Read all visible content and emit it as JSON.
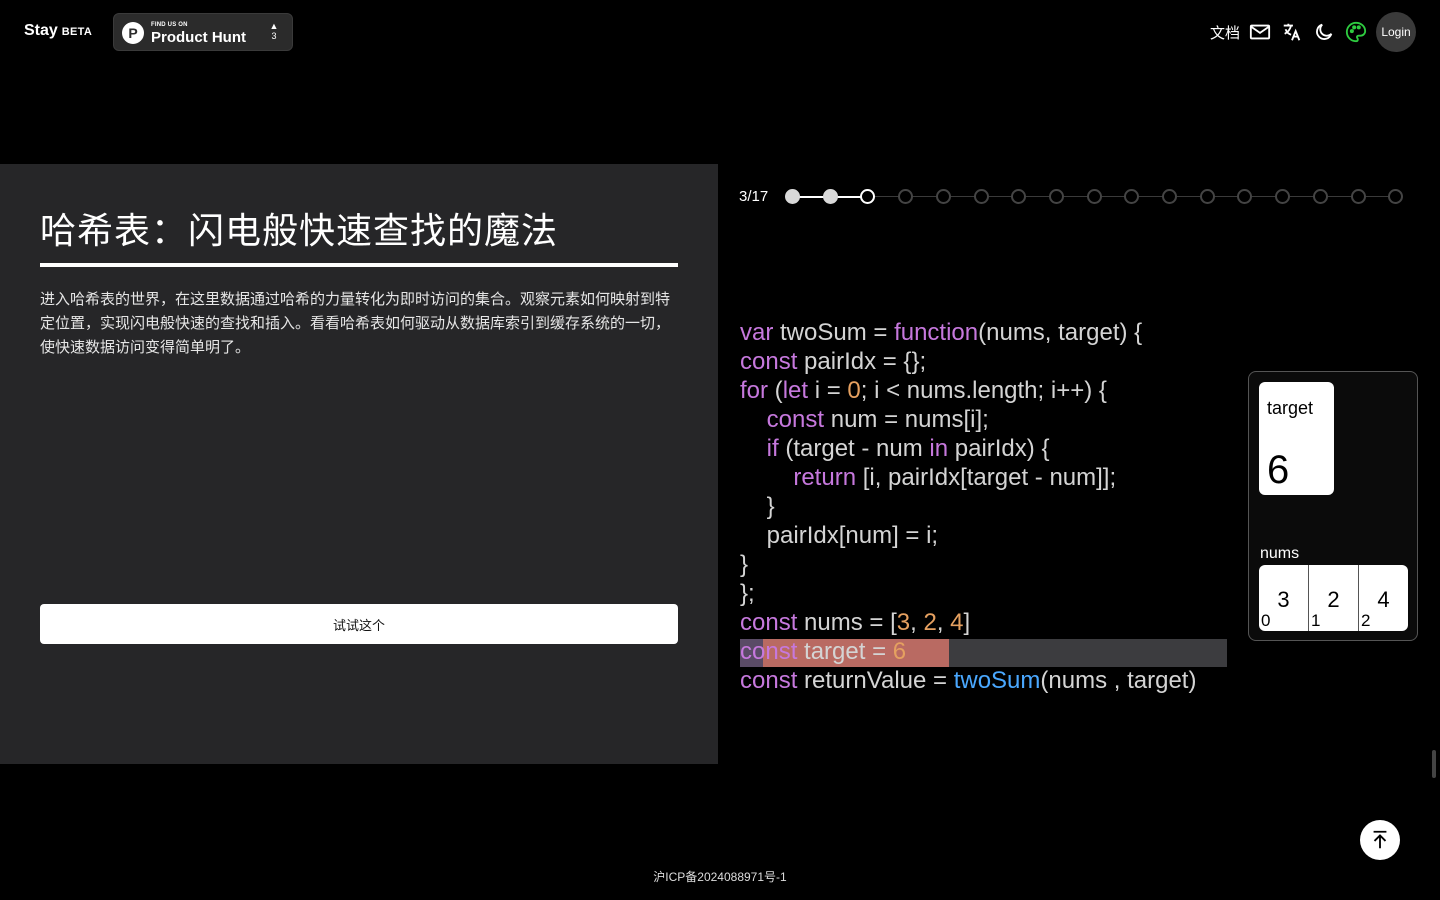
{
  "header": {
    "brand": "Stay",
    "brand_tag": "BETA",
    "product_hunt": {
      "small": "FIND US ON",
      "name": "Product Hunt",
      "logo": "P",
      "arrow": "▲",
      "votes": "3"
    },
    "docs": "文档",
    "login": "Login",
    "icons": [
      "mail-icon",
      "translate-icon",
      "moon-icon",
      "palette-icon"
    ]
  },
  "lesson": {
    "title": "哈希表：闪电般快速查找的魔法",
    "description": "进入哈希表的世界，在这里数据通过哈希的力量转化为即时访问的集合。观察元素如何映射到特定位置，实现闪电般快速的查找和插入。看看哈希表如何驱动从数据库索引到缓存系统的一切，使快速数据访问变得简单明了。",
    "try_button": "试试这个"
  },
  "progress": {
    "label": "3/17",
    "current": 3,
    "total": 17
  },
  "code_lines": [
    [
      {
        "t": "var",
        "c": "kw"
      },
      {
        "t": " twoSum = "
      },
      {
        "t": "function",
        "c": "kw"
      },
      {
        "t": "(nums, target) {"
      }
    ],
    [
      {
        "t": "const",
        "c": "kw"
      },
      {
        "t": " pairIdx = {};"
      }
    ],
    [
      {
        "t": "for",
        "c": "kw"
      },
      {
        "t": " ("
      },
      {
        "t": "let",
        "c": "kw"
      },
      {
        "t": " i = "
      },
      {
        "t": "0",
        "c": "num"
      },
      {
        "t": "; i < nums.length; i++) {"
      }
    ],
    [
      {
        "t": "    "
      },
      {
        "t": "const",
        "c": "kw"
      },
      {
        "t": " num = nums[i];"
      }
    ],
    [
      {
        "t": "    "
      },
      {
        "t": "if",
        "c": "kw"
      },
      {
        "t": " (target - num "
      },
      {
        "t": "in",
        "c": "kw"
      },
      {
        "t": " pairIdx) {"
      }
    ],
    [
      {
        "t": "        "
      },
      {
        "t": "return",
        "c": "kw"
      },
      {
        "t": " [i, pairIdx[target - num]];"
      }
    ],
    [
      {
        "t": "    }"
      }
    ],
    [
      {
        "t": "    pairIdx[num] = i;"
      }
    ],
    [
      {
        "t": "}"
      }
    ],
    [
      {
        "t": "};"
      }
    ],
    [
      {
        "t": "const",
        "c": "kw"
      },
      {
        "t": " nums = ["
      },
      {
        "t": "3",
        "c": "num"
      },
      {
        "t": ", "
      },
      {
        "t": "2",
        "c": "num"
      },
      {
        "t": ", "
      },
      {
        "t": "4",
        "c": "num"
      },
      {
        "t": "]"
      }
    ],
    [
      {
        "t": "const",
        "c": "kw"
      },
      {
        "t": " target = "
      },
      {
        "t": "6",
        "c": "num"
      }
    ],
    [
      {
        "t": "const",
        "c": "kw"
      },
      {
        "t": " returnValue = "
      },
      {
        "t": "twoSum",
        "c": "fn"
      },
      {
        "t": "(nums , target)"
      }
    ]
  ],
  "variables": {
    "target": {
      "name": "target",
      "value": "6"
    },
    "nums": {
      "name": "nums",
      "cells": [
        {
          "v": "3",
          "i": "0"
        },
        {
          "v": "2",
          "i": "1"
        },
        {
          "v": "4",
          "i": "2"
        }
      ]
    }
  },
  "footer": {
    "icp": "沪ICP备2024088971号-1"
  }
}
